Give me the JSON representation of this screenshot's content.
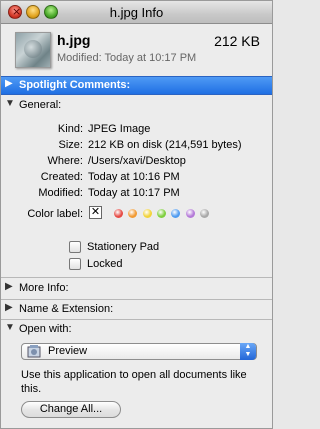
{
  "window": {
    "title": "h.jpg Info"
  },
  "file": {
    "name": "h.jpg",
    "size": "212 KB",
    "modified": "Modified: Today at 10:17 PM"
  },
  "sections": {
    "spotlight": "Spotlight Comments:",
    "general": "General:",
    "more_info": "More Info:",
    "name_ext": "Name & Extension:",
    "open_with": "Open with:"
  },
  "general": {
    "kind_label": "Kind:",
    "kind": "JPEG Image",
    "size_label": "Size:",
    "size": "212 KB on disk (214,591 bytes)",
    "where_label": "Where:",
    "where": "/Users/xavi/Desktop",
    "created_label": "Created:",
    "created": "Today at 10:16 PM",
    "modified_label": "Modified:",
    "modified": "Today at 10:17 PM",
    "color_label": "Color label:",
    "color_none": "✕",
    "label_colors": [
      "#e64b45",
      "#f29a33",
      "#f2d33a",
      "#7fcf3f",
      "#4f9bf0",
      "#b47ad8",
      "#a8a8a8"
    ],
    "stationery": "Stationery Pad",
    "locked": "Locked"
  },
  "open_with": {
    "app": "Preview",
    "description": "Use this application to open all documents like this.",
    "change_all": "Change All..."
  }
}
